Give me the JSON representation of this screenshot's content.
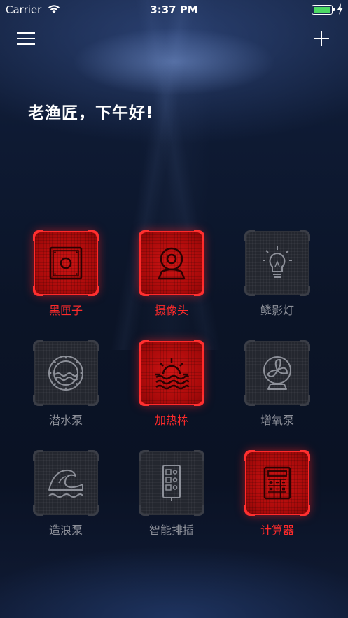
{
  "status_bar": {
    "carrier": "Carrier",
    "time": "3:37 PM",
    "battery_color": "#4cd964"
  },
  "nav": {
    "menu_icon": "hamburger-menu-icon",
    "add_icon": "plus-icon"
  },
  "greeting": "老渔匠，下午好!",
  "colors": {
    "active": "#ff2b2b",
    "inactive": "#8d9099"
  },
  "devices": [
    {
      "label": "黑匣子",
      "icon": "black-box-icon",
      "active": true
    },
    {
      "label": "摄像头",
      "icon": "camera-icon",
      "active": true
    },
    {
      "label": "鳞影灯",
      "icon": "light-bulb-icon",
      "active": false
    },
    {
      "label": "潜水泵",
      "icon": "submersible-pump-icon",
      "active": false
    },
    {
      "label": "加热棒",
      "icon": "heater-sun-icon",
      "active": true
    },
    {
      "label": "增氧泵",
      "icon": "fan-icon",
      "active": false
    },
    {
      "label": "造浪泵",
      "icon": "wave-icon",
      "active": false
    },
    {
      "label": "智能排插",
      "icon": "power-strip-icon",
      "active": false
    },
    {
      "label": "计算器",
      "icon": "calculator-icon",
      "active": true
    }
  ]
}
